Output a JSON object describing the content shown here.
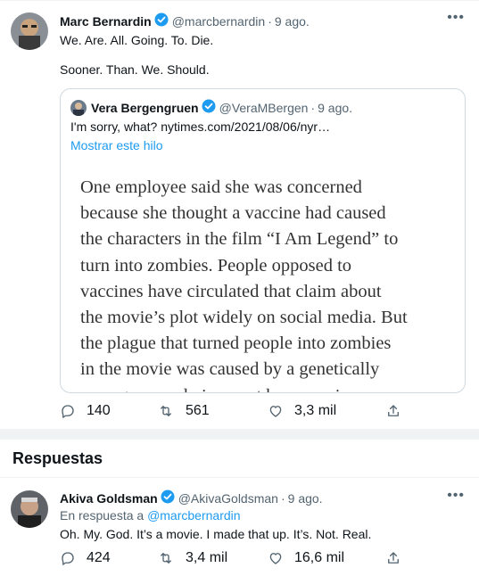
{
  "main_tweet": {
    "name": "Marc Bernardin",
    "handle": "@marcbernardin",
    "dot": "·",
    "time": "9 ago.",
    "line1": "We. Are. All. Going. To. Die.",
    "line2": "Sooner. Than. We. Should.",
    "more": "•••",
    "quote": {
      "name": "Vera Bergengruen",
      "handle": "@VeraMBergen",
      "dot": "·",
      "time": "9 ago.",
      "text": "I'm sorry, what? nytimes.com/2021/08/06/nyr…",
      "show_thread": "Mostrar este hilo",
      "article_lines": [
        "One employee said she was concerned",
        "because she thought a vaccine had caused",
        "the characters in the film “I Am Legend” to",
        "turn into zombies. People opposed to",
        "vaccines have circulated that claim about",
        "the movie’s plot widely on social media. But",
        "the plague that turned people into zombies",
        "in the movie was caused by a genetically",
        "reprogrammed virus, not by a vaccine."
      ]
    },
    "actions": {
      "replies": "140",
      "retweets": "561",
      "likes": "3,3 mil"
    }
  },
  "section_title": "Respuestas",
  "reply_tweet": {
    "name": "Akiva Goldsman",
    "handle": "@AkivaGoldsman",
    "dot": "·",
    "time": "9 ago.",
    "reply_prefix": "En respuesta a",
    "reply_handle": "@marcbernardin",
    "text": "Oh. My. God. It’s a movie. I made that up. It’s. Not. Real.",
    "more": "•••",
    "actions": {
      "replies": "424",
      "retweets": "3,4 mil",
      "likes": "16,6 mil"
    }
  },
  "colors": {
    "accent": "#1d9bf0",
    "muted": "#536471",
    "border": "#cfd9de",
    "divider": "#eff3f4"
  }
}
